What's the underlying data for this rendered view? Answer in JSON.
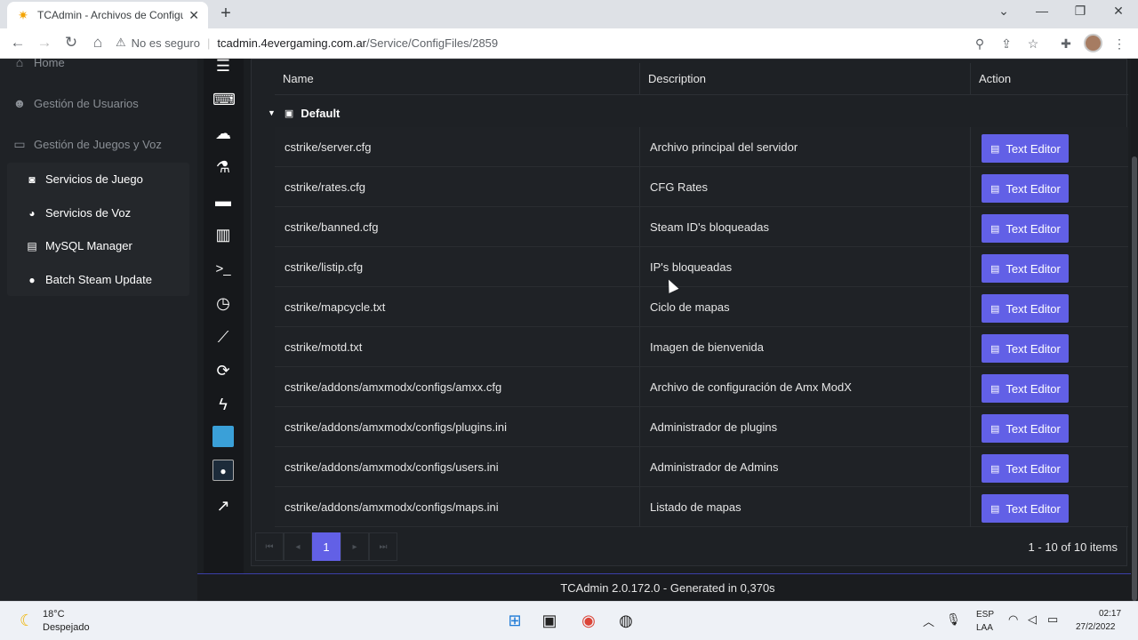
{
  "browser": {
    "tab_title": "TCAdmin - Archivos de Configura",
    "address_warning": "No es seguro",
    "address_host": "tcadmin.4evergaming.com.ar",
    "address_path": "/Service/ConfigFiles/2859"
  },
  "leftnav": {
    "home": "Home",
    "users": "Gestión de Usuarios",
    "games_voice": "Gestión de Juegos y Voz",
    "sub": [
      {
        "label": "Servicios de Juego",
        "icon": "gamepad-icon"
      },
      {
        "label": "Servicios de Voz",
        "icon": "headset-icon"
      },
      {
        "label": "MySQL Manager",
        "icon": "database-icon"
      },
      {
        "label": "Batch Steam Update",
        "icon": "steam-icon"
      }
    ]
  },
  "table": {
    "headers": {
      "name": "Name",
      "description": "Description",
      "action": "Action"
    },
    "group": "Default",
    "action_label": "Text Editor",
    "rows": [
      {
        "name": "cstrike/server.cfg",
        "description": "Archivo principal del servidor"
      },
      {
        "name": "cstrike/rates.cfg",
        "description": "CFG Rates"
      },
      {
        "name": "cstrike/banned.cfg",
        "description": "Steam ID's bloqueadas"
      },
      {
        "name": "cstrike/listip.cfg",
        "description": "IP's bloqueadas"
      },
      {
        "name": "cstrike/mapcycle.txt",
        "description": "Ciclo de mapas"
      },
      {
        "name": "cstrike/motd.txt",
        "description": "Imagen de bienvenida"
      },
      {
        "name": "cstrike/addons/amxmodx/configs/amxx.cfg",
        "description": "Archivo de configuración de Amx ModX"
      },
      {
        "name": "cstrike/addons/amxmodx/configs/plugins.ini",
        "description": "Administrador de plugins"
      },
      {
        "name": "cstrike/addons/amxmodx/configs/users.ini",
        "description": "Administrador de Admins"
      },
      {
        "name": "cstrike/addons/amxmodx/configs/maps.ini",
        "description": "Listado de mapas"
      }
    ]
  },
  "pager": {
    "current": "1",
    "info": "1 - 10 of 10 items"
  },
  "footer": "TCAdmin 2.0.172.0 - Generated in 0,370s",
  "taskbar": {
    "temp": "18°C",
    "weather": "Despejado",
    "lang1": "ESP",
    "lang2": "LAA",
    "time": "02:17",
    "date": "27/2/2022"
  },
  "colors": {
    "accent": "#6260e6",
    "panel": "#1e2125"
  }
}
